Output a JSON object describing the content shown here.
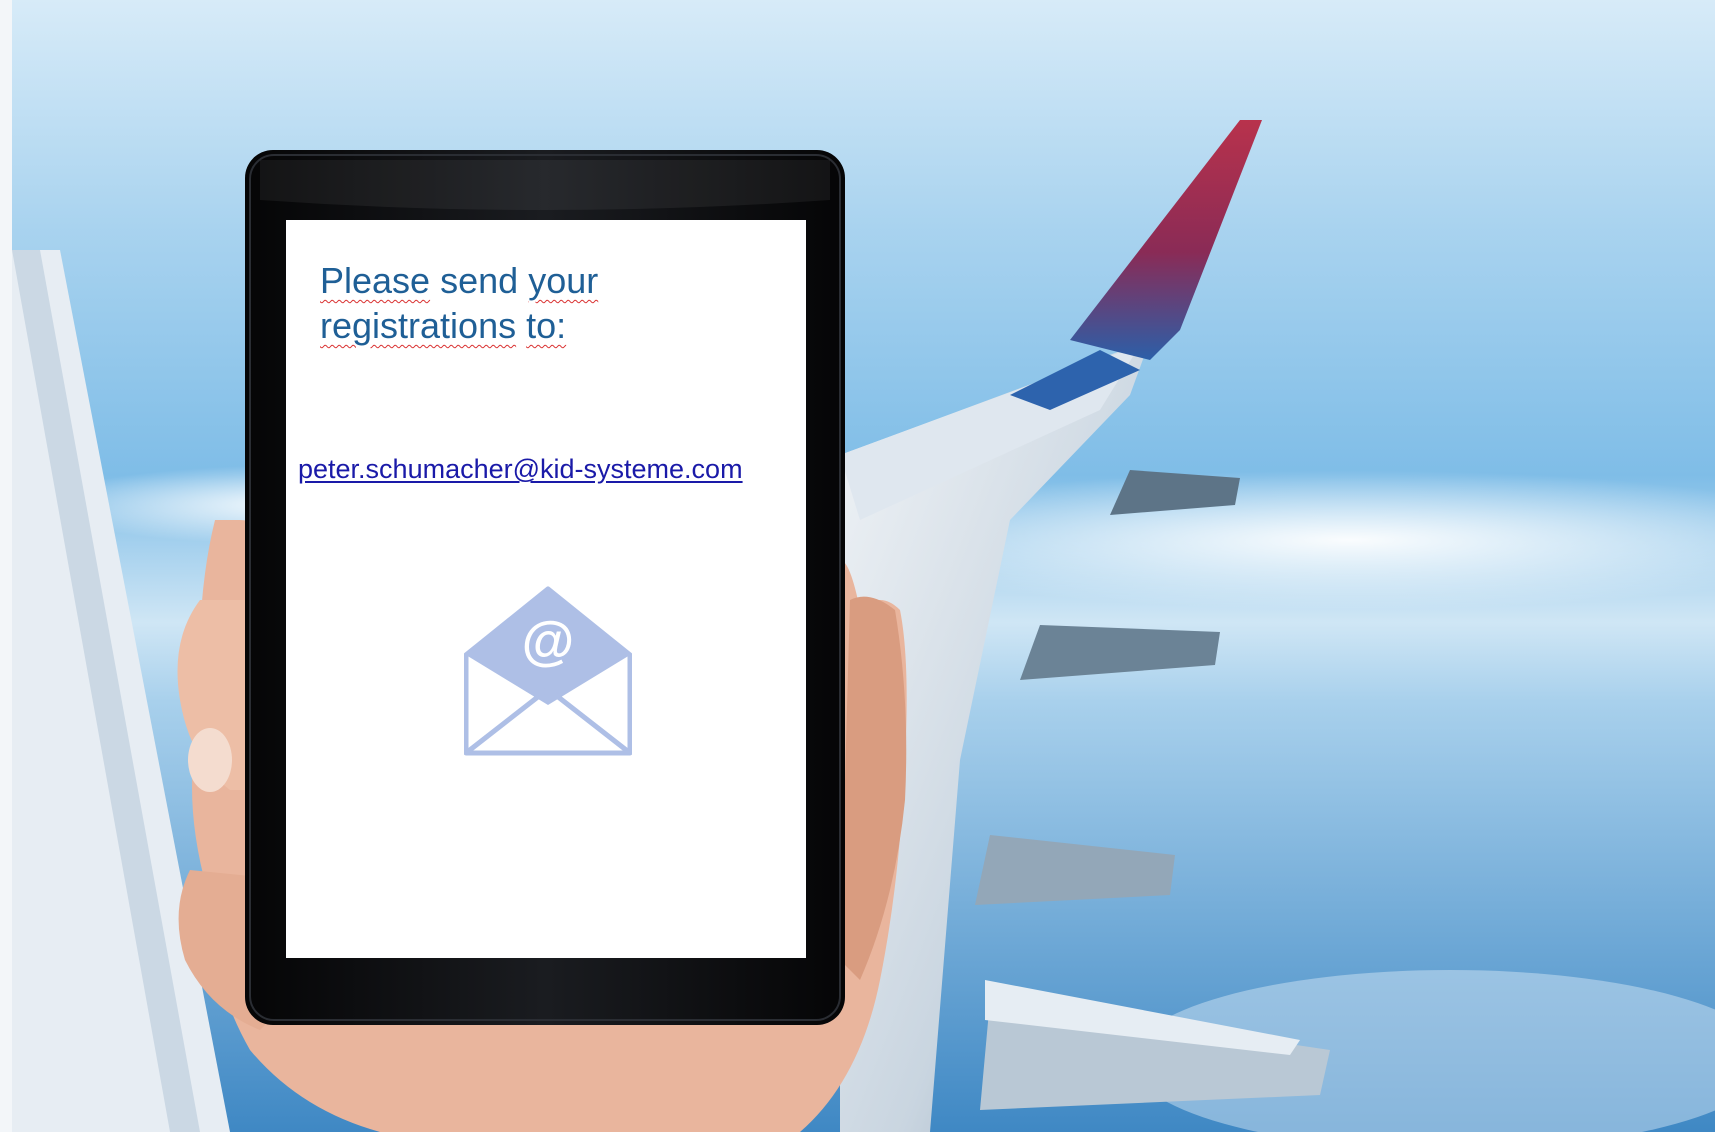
{
  "screen": {
    "heading_words": [
      "Please",
      "send",
      "your",
      "registrations",
      "to:"
    ],
    "email": "peter.schumacher@kid-systeme.com"
  },
  "icons": {
    "envelope": "envelope-at-icon",
    "at_symbol": "@"
  },
  "colors": {
    "heading_text": "#1f5f96",
    "link_text": "#1a1aa8",
    "spellcheck_underline": "#d93030",
    "icon": "#aebfe6",
    "tablet_frame": "#0b0b0c",
    "sky": "#8cc4ea"
  }
}
